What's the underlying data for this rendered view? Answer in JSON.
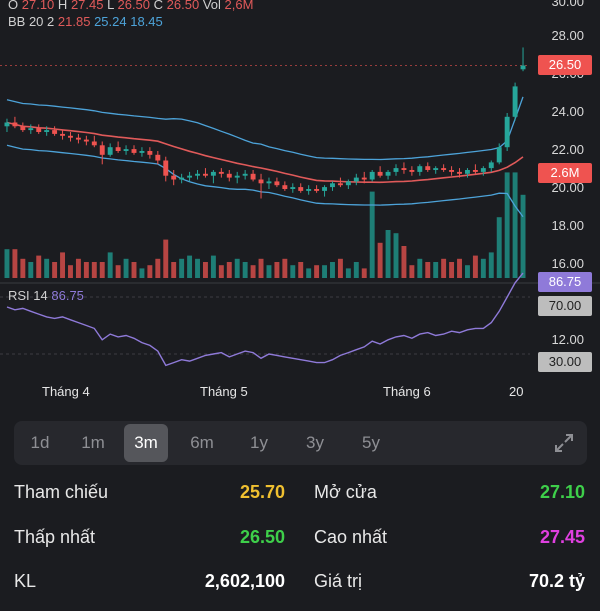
{
  "ohlc": {
    "o_label": "O",
    "o_value": "27.10",
    "h_label": "H",
    "h_value": "27.45",
    "l_label": "L",
    "l_value": "26.50",
    "c_label": "C",
    "c_value": "26.50",
    "vol_label": "Vol",
    "vol_value": "2,6M"
  },
  "bb": {
    "label": "BB 20 2",
    "upper": "21.85",
    "middle": "25.24",
    "lower": "18.45"
  },
  "rsi": {
    "label": "RSI 14",
    "value": "86.75"
  },
  "price_ticks": [
    "30.00",
    "28.00",
    "26.00",
    "24.00",
    "22.00",
    "20.00",
    "18.00",
    "16.00"
  ],
  "rsi_ticks": [
    "12.00"
  ],
  "tags": {
    "price": "26.50",
    "volume": "2.6M",
    "rsi": "86.75",
    "rsi_high": "70.00",
    "rsi_low": "30.00"
  },
  "x_ticks": [
    "Tháng 4",
    "Tháng 5",
    "Tháng 6",
    "20"
  ],
  "periods": [
    "1d",
    "1m",
    "3m",
    "6m",
    "1y",
    "3y",
    "5y"
  ],
  "active_period": "3m",
  "stats": {
    "reference_label": "Tham chiếu",
    "reference_value": "25.70",
    "open_label": "Mở cửa",
    "open_value": "27.10",
    "low_label": "Thấp nhất",
    "low_value": "26.50",
    "high_label": "Cao nhất",
    "high_value": "27.45",
    "volume_label": "KL",
    "volume_value": "2,602,100",
    "value_label": "Giá trị",
    "value_value": "70.2 tỷ"
  },
  "colors": {
    "up": "#26a69a",
    "down": "#ef5350",
    "upper_band": "#4da3d9",
    "mid_band": "#e05a5a",
    "rsi": "#8f7ad9",
    "reference": "#f0c030",
    "green": "#3ecf4a",
    "magenta": "#e040e0"
  },
  "chart_data": {
    "type": "candlestick",
    "ylim": [
      15,
      30
    ],
    "candles": [
      [
        23.3,
        23.7,
        23.0,
        23.5
      ],
      [
        23.5,
        23.8,
        23.2,
        23.3
      ],
      [
        23.3,
        23.5,
        23.0,
        23.1
      ],
      [
        23.1,
        23.4,
        22.9,
        23.2
      ],
      [
        23.2,
        23.4,
        22.9,
        23.0
      ],
      [
        23.0,
        23.3,
        22.8,
        23.1
      ],
      [
        23.1,
        23.3,
        22.8,
        22.9
      ],
      [
        22.9,
        23.1,
        22.6,
        22.8
      ],
      [
        22.8,
        23.0,
        22.5,
        22.7
      ],
      [
        22.7,
        22.9,
        22.4,
        22.6
      ],
      [
        22.6,
        22.8,
        22.3,
        22.5
      ],
      [
        22.5,
        22.8,
        22.2,
        22.3
      ],
      [
        22.3,
        22.5,
        21.3,
        21.8
      ],
      [
        21.8,
        22.4,
        21.7,
        22.2
      ],
      [
        22.2,
        22.5,
        21.9,
        22.0
      ],
      [
        22.0,
        22.3,
        21.8,
        22.1
      ],
      [
        22.1,
        22.3,
        21.8,
        21.9
      ],
      [
        21.9,
        22.2,
        21.7,
        22.0
      ],
      [
        22.0,
        22.2,
        21.6,
        21.8
      ],
      [
        21.8,
        22.0,
        21.3,
        21.5
      ],
      [
        21.5,
        21.7,
        20.4,
        20.7
      ],
      [
        20.7,
        21.0,
        20.2,
        20.5
      ],
      [
        20.5,
        20.8,
        20.3,
        20.6
      ],
      [
        20.6,
        20.9,
        20.4,
        20.7
      ],
      [
        20.7,
        21.0,
        20.5,
        20.8
      ],
      [
        20.8,
        21.1,
        20.6,
        20.7
      ],
      [
        20.7,
        21.0,
        20.3,
        20.9
      ],
      [
        20.9,
        21.1,
        20.6,
        20.8
      ],
      [
        20.8,
        21.0,
        20.4,
        20.6
      ],
      [
        20.6,
        20.9,
        20.3,
        20.7
      ],
      [
        20.7,
        21.0,
        20.5,
        20.8
      ],
      [
        20.8,
        21.0,
        20.4,
        20.5
      ],
      [
        20.5,
        20.8,
        19.5,
        20.3
      ],
      [
        20.3,
        20.6,
        20.0,
        20.4
      ],
      [
        20.4,
        20.6,
        20.1,
        20.2
      ],
      [
        20.2,
        20.4,
        19.9,
        20.0
      ],
      [
        20.0,
        20.3,
        19.8,
        20.1
      ],
      [
        20.1,
        20.3,
        19.8,
        19.9
      ],
      [
        19.9,
        20.2,
        19.7,
        20.0
      ],
      [
        20.0,
        20.2,
        19.8,
        19.9
      ],
      [
        19.9,
        20.2,
        19.6,
        20.1
      ],
      [
        20.1,
        20.4,
        19.9,
        20.3
      ],
      [
        20.3,
        20.6,
        20.1,
        20.2
      ],
      [
        20.2,
        20.5,
        20.0,
        20.4
      ],
      [
        20.4,
        20.8,
        20.2,
        20.6
      ],
      [
        20.6,
        20.9,
        20.3,
        20.5
      ],
      [
        20.5,
        21.0,
        20.4,
        20.9
      ],
      [
        20.9,
        21.2,
        20.6,
        20.7
      ],
      [
        20.7,
        21.0,
        20.5,
        20.9
      ],
      [
        20.9,
        21.3,
        20.7,
        21.1
      ],
      [
        21.1,
        21.4,
        20.8,
        21.0
      ],
      [
        21.0,
        21.2,
        20.7,
        20.9
      ],
      [
        20.9,
        21.3,
        20.7,
        21.2
      ],
      [
        21.2,
        21.4,
        20.9,
        21.0
      ],
      [
        21.0,
        21.2,
        20.8,
        21.1
      ],
      [
        21.1,
        21.3,
        20.9,
        21.0
      ],
      [
        21.0,
        21.2,
        20.7,
        20.9
      ],
      [
        20.9,
        21.1,
        20.6,
        20.8
      ],
      [
        20.8,
        21.1,
        20.6,
        21.0
      ],
      [
        21.0,
        21.3,
        20.8,
        20.9
      ],
      [
        20.9,
        21.2,
        20.7,
        21.1
      ],
      [
        21.1,
        21.5,
        20.9,
        21.4
      ],
      [
        21.4,
        22.4,
        21.3,
        22.2
      ],
      [
        22.2,
        24.0,
        22.0,
        23.8
      ],
      [
        23.8,
        25.6,
        23.6,
        25.4
      ],
      [
        26.3,
        27.45,
        26.2,
        26.5
      ]
    ],
    "volumes": [
      0.9,
      0.9,
      0.6,
      0.5,
      0.7,
      0.6,
      0.5,
      0.8,
      0.4,
      0.6,
      0.5,
      0.5,
      0.5,
      0.8,
      0.4,
      0.6,
      0.5,
      0.3,
      0.4,
      0.6,
      1.2,
      0.5,
      0.6,
      0.7,
      0.6,
      0.5,
      0.7,
      0.4,
      0.5,
      0.6,
      0.5,
      0.4,
      0.6,
      0.4,
      0.5,
      0.6,
      0.4,
      0.5,
      0.3,
      0.4,
      0.4,
      0.5,
      0.6,
      0.3,
      0.5,
      0.3,
      2.7,
      1.1,
      1.5,
      1.4,
      1.0,
      0.4,
      0.6,
      0.5,
      0.5,
      0.6,
      0.5,
      0.6,
      0.4,
      0.7,
      0.6,
      0.8,
      1.9,
      3.3,
      3.3,
      2.6
    ],
    "volume_max": 3.5,
    "rsi": [
      63,
      61,
      62,
      60,
      58,
      56,
      55,
      56,
      54,
      52,
      50,
      48,
      40,
      44,
      42,
      43,
      41,
      38,
      36,
      32,
      22,
      24,
      26,
      25,
      27,
      29,
      30,
      31,
      28,
      30,
      32,
      31,
      27,
      30,
      29,
      28,
      27,
      26,
      25,
      24,
      24,
      26,
      29,
      31,
      33,
      35,
      39,
      37,
      40,
      42,
      43,
      41,
      44,
      45,
      43,
      44,
      46,
      45,
      47,
      48,
      48,
      52,
      60,
      70,
      80,
      86.75
    ],
    "rsi_levels": [
      70,
      30
    ]
  }
}
